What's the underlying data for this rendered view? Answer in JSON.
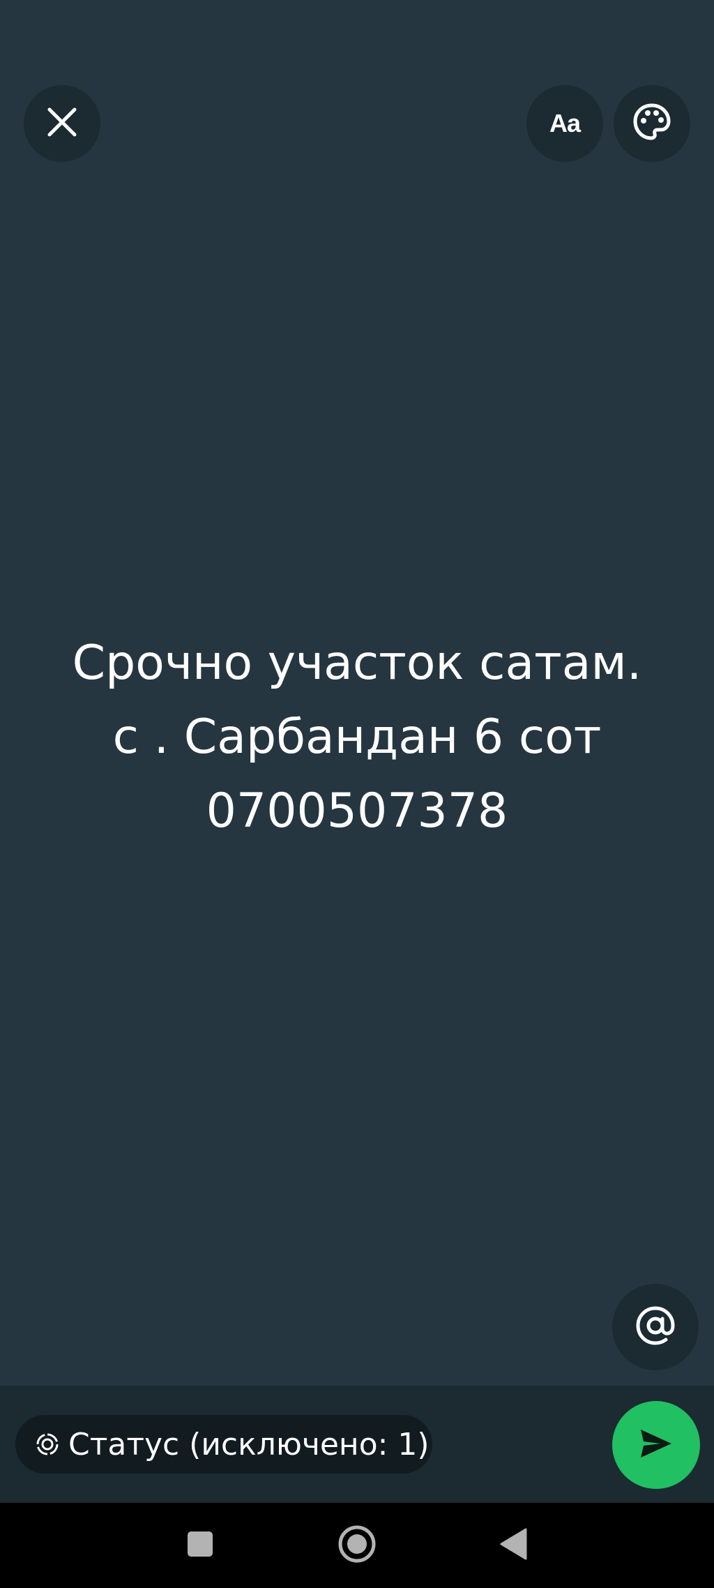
{
  "toolbar": {
    "close_icon": "close-icon",
    "font_button_label": "Aa",
    "palette_icon": "palette-icon"
  },
  "status": {
    "text": "Срочно участок сатам.\nс . Сарбандан 6 сот\n0700507378",
    "background_color": "#263640",
    "text_color": "#ffffff"
  },
  "mention": {
    "icon": "at-sign-icon"
  },
  "composer": {
    "audience_icon": "status-ring-icon",
    "audience_label": "Статус (исключено: 1)",
    "send_icon": "send-icon",
    "send_color": "#21c063"
  },
  "navigation": {
    "recents_icon": "square-icon",
    "home_icon": "circle-home-icon",
    "back_icon": "triangle-back-icon"
  }
}
